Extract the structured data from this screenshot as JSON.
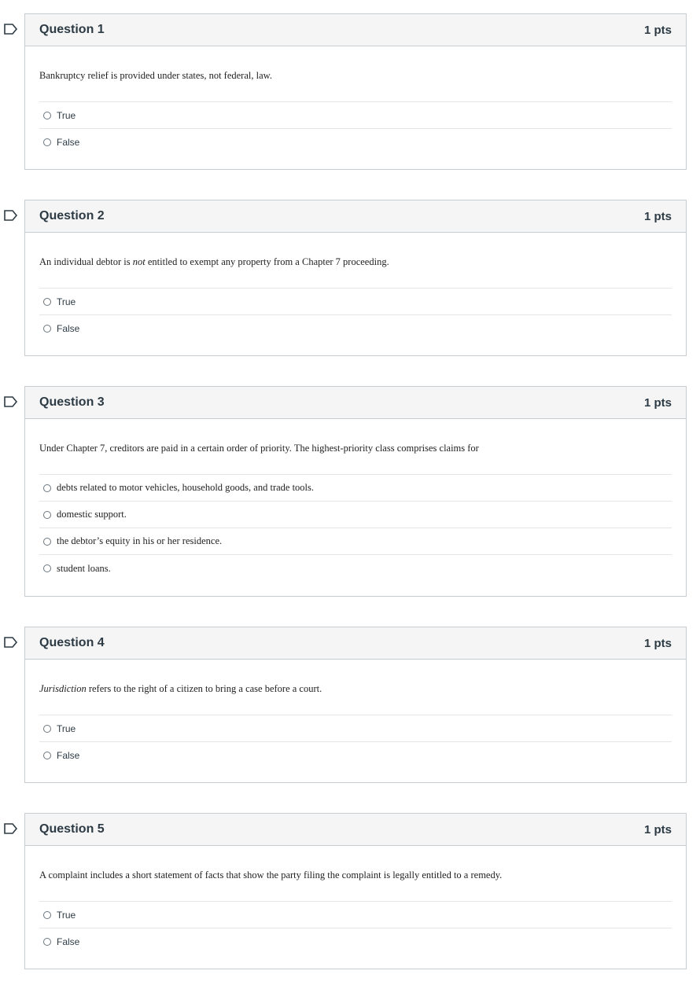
{
  "questions": [
    {
      "title": "Question 1",
      "points": "1 pts",
      "text_parts": [
        "Bankruptcy relief is provided under states, not federal, law.",
        "",
        ""
      ],
      "answers": [
        "True",
        "False"
      ],
      "serif_answers": false
    },
    {
      "title": "Question 2",
      "points": "1 pts",
      "text_parts": [
        "An individual debtor is ",
        "not",
        " entitled to exempt any property from a Chapter 7 proceeding."
      ],
      "answers": [
        "True",
        "False"
      ],
      "serif_answers": false
    },
    {
      "title": "Question 3",
      "points": "1 pts",
      "text_parts": [
        "Under Chapter 7, creditors are paid in a certain order of priority. The highest-priority class comprises claims for",
        "",
        ""
      ],
      "answers": [
        "debts related to motor vehicles, household goods, and trade tools.",
        "domestic support.",
        "the debtor’s equity in his or her residence.",
        "student loans."
      ],
      "serif_answers": true
    },
    {
      "title": "Question 4",
      "points": "1 pts",
      "text_parts": [
        "",
        "Jurisdiction",
        " refers to the right of a citizen to bring a case before a court."
      ],
      "answers": [
        "True",
        "False"
      ],
      "serif_answers": false
    },
    {
      "title": "Question 5",
      "points": "1 pts",
      "text_parts": [
        "A complaint includes a short statement of facts that show the party filing the complaint is legally entitled to a remedy.",
        "",
        ""
      ],
      "answers": [
        "True",
        "False"
      ],
      "serif_answers": false
    }
  ]
}
